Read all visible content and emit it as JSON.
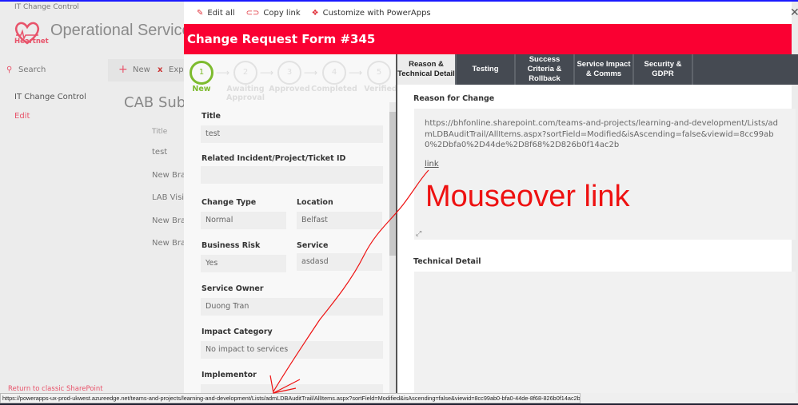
{
  "background": {
    "breadcrumb": "IT Change Control",
    "site_title": "Operational Services",
    "logo_text": "Heartnet",
    "search": "Search",
    "new_label": "New",
    "export_label": "Expo",
    "nav": [
      "IT Change Control",
      "Edit"
    ],
    "page_title": "CAB Subm",
    "column_header": "Title",
    "rows": [
      "test",
      "New Branc",
      "LAB Visits",
      "New Branc",
      "New Branc"
    ],
    "return_link": "Return to classic SharePoint"
  },
  "modal": {
    "commands": [
      {
        "icon": "pencil-icon",
        "label": "Edit all"
      },
      {
        "icon": "link-icon",
        "label": "Copy link"
      },
      {
        "icon": "powerapps-icon",
        "label": "Customize with PowerApps"
      }
    ],
    "title": "Change Request Form #345",
    "steps": [
      {
        "n": "1",
        "label": "New",
        "active": true
      },
      {
        "n": "2",
        "label": "Awaiting Approval"
      },
      {
        "n": "3",
        "label": "Approved"
      },
      {
        "n": "4",
        "label": "Completed"
      },
      {
        "n": "5",
        "label": "Verified"
      }
    ],
    "fields": {
      "title_label": "Title",
      "title_value": "test",
      "related_label": "Related Incident/Project/Ticket ID",
      "related_value": "",
      "change_type_label": "Change Type",
      "change_type_value": "Normal",
      "location_label": "Location",
      "location_value": "Belfast",
      "risk_label": "Business Risk",
      "risk_value": "Yes",
      "service_label": "Service",
      "service_value": "asdasd",
      "owner_label": "Service Owner",
      "owner_value": "Duong Tran",
      "impact_label": "Impact Category",
      "impact_value": "No impact to services",
      "implementor_label": "Implementor"
    },
    "tabs": [
      "Reason & Technical Detail",
      "Testing",
      "Success Criteria & Rollback",
      "Service Impact & Comms",
      "Security & GDPR"
    ],
    "reason_label": "Reason for Change",
    "reason_text": "https://bhfonline.sharepoint.com/teams-and-projects/learning-and-development/Lists/admLDBAuditTrail/AllItems.aspx?sortField=Modified&isAscending=false&viewid=8cc99ab0%2Dbfa0%2D44de%2D8f68%2D826b0f14ac2b",
    "reason_link": "link",
    "technical_label": "Technical Detail",
    "accent": "#fa0032",
    "step_active_color": "#7dbb2e"
  },
  "annotation": "Mouseover link",
  "status_url": "https://powerapps-ux-prod-ukwest.azureedge.net/teams-and-projects/learning-and-development/Lists/admLDBAuditTrail/AllItems.aspx?sortField=Modified&isAscending=false&viewid=8cc99ab0-bfa0-44de-8f68-826b0f14ac2b"
}
